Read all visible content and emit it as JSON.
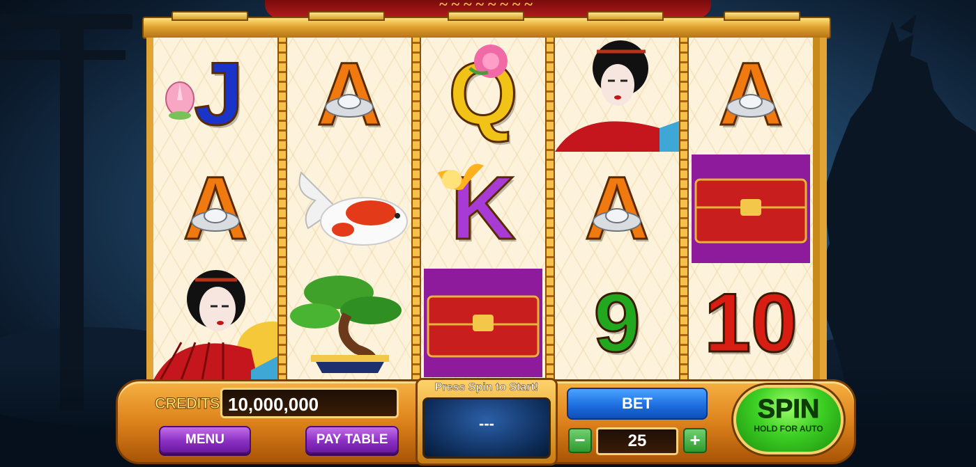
{
  "game": {
    "credits_label": "CREDITS",
    "credits_value": "10,000,000",
    "menu_label": "MENU",
    "paytable_label": "PAY TABLE",
    "status_text": "Press Spin to Start!",
    "win_display": "---",
    "bet_label": "BET",
    "bet_value": "25",
    "minus_label": "−",
    "plus_label": "+",
    "spin_label": "SPIN",
    "spin_sublabel": "HOLD FOR AUTO"
  },
  "reels": [
    [
      "J",
      "A",
      "geisha"
    ],
    [
      "A",
      "koi",
      "bonsai"
    ],
    [
      "Q",
      "K",
      "chest"
    ],
    [
      "geisha",
      "A",
      "9"
    ],
    [
      "A",
      "chest",
      "10"
    ]
  ],
  "symbol_colors": {
    "J": "#1a33c8",
    "A": "#f07a10",
    "Q": "#f2c317",
    "K": "#a83ad6",
    "9": "#22a81e",
    "10": "#d81e12"
  }
}
